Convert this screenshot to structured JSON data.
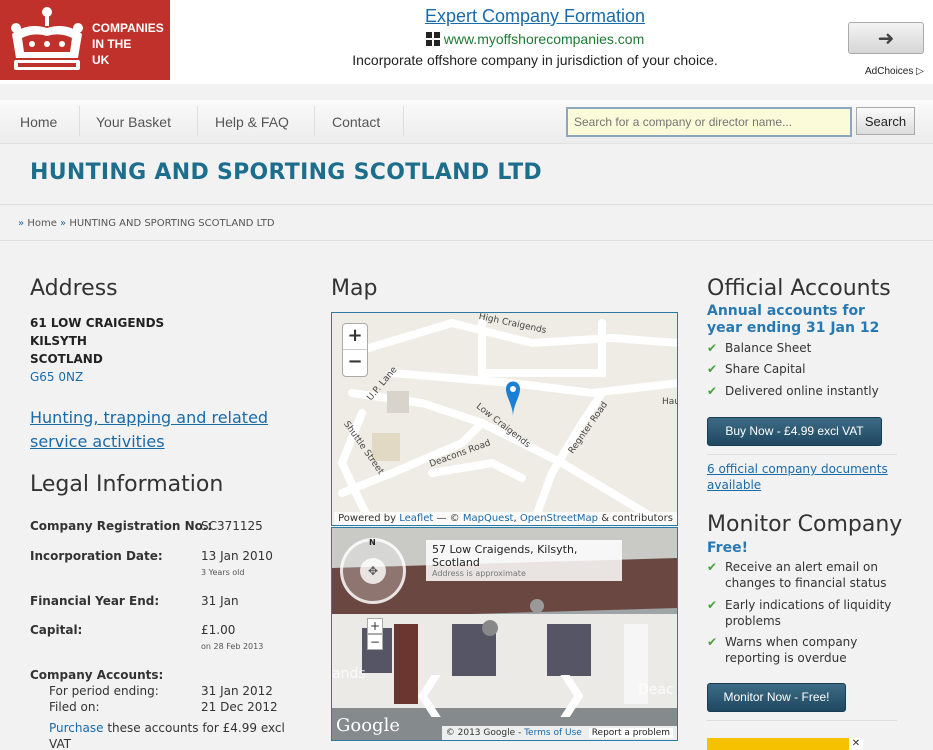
{
  "logo": {
    "line1": "COMPANIES",
    "line2": "IN THE",
    "line3": "UK"
  },
  "ad": {
    "title": "Expert Company Formation",
    "url": "www.myoffshorecompanies.com",
    "description": "Incorporate offshore company in jurisdiction of your choice.",
    "arrow": "➜",
    "adchoices": "AdChoices ▷"
  },
  "nav": {
    "items": [
      "Home",
      "Your Basket",
      "Help & FAQ",
      "Contact"
    ],
    "search_placeholder": "Search for a company or director name...",
    "search_button": "Search"
  },
  "page_title": "HUNTING AND SPORTING SCOTLAND LTD",
  "breadcrumb": {
    "sep": "»",
    "home": "Home",
    "current": "HUNTING AND SPORTING SCOTLAND LTD"
  },
  "address": {
    "heading": "Address",
    "line1": "61 LOW CRAIGENDS",
    "line2": "KILSYTH",
    "line3": "SCOTLAND",
    "postcode": "G65 0NZ",
    "activity": "Hunting, trapping and related service activities"
  },
  "legal": {
    "heading": "Legal Information",
    "reg_label": "Company Registration No.:",
    "reg_value": "SC371125",
    "inc_label": "Incorporation Date:",
    "inc_value": "13 Jan 2010",
    "inc_sub": "3 Years old",
    "fye_label": "Financial Year End:",
    "fye_value": "31 Jan",
    "cap_label": "Capital:",
    "cap_value": "£1.00",
    "cap_sub": "on 28 Feb 2013",
    "acc_label": "Company Accounts:",
    "period_label": "For period ending:",
    "period_value": "31 Jan 2012",
    "filed_label": "Filed on:",
    "filed_value": "21 Dec 2012",
    "purchase_link": "Purchase",
    "purchase_rest": " these accounts for £4.99 excl VAT"
  },
  "map": {
    "heading": "Map",
    "zoom_in": "+",
    "zoom_out": "−",
    "streets": [
      "High Craigends",
      "U.P. Lane",
      "Low Craigends",
      "Shuttle Street",
      "Deacons Road",
      "Regnter Road",
      "Hau"
    ],
    "attr_prefix": "Powered by ",
    "attr_leaflet": "Leaflet",
    "attr_mid": " — © ",
    "attr_mapquest": "MapQuest",
    "attr_sep": ", ",
    "attr_osm": "OpenStreetMap",
    "attr_suffix": " & contributors",
    "sv_address": "57 Low Craigends, Kilsyth, Scotland",
    "sv_approx": "Address is approximate",
    "sv_google": "Google",
    "sv_copyright": "© 2013 Google - ",
    "sv_terms": "Terms of Use",
    "sv_report": "Report a problem",
    "sv_compass": "N",
    "sv_deac": "Deac",
    "sv_ands": "ands"
  },
  "accounts": {
    "heading": "Official Accounts",
    "subheading": "Annual accounts for year ending 31 Jan 12",
    "items": [
      "Balance Sheet",
      "Share Capital",
      "Delivered online instantly"
    ],
    "buy_button": "Buy Now - £4.99 excl VAT",
    "docs_link": "6 official company documents available"
  },
  "monitor": {
    "heading": "Monitor Company",
    "free": "Free!",
    "items": [
      "Receive an alert email on changes to financial status",
      "Early indications of liquidity problems",
      "Warns when company reporting is overdue"
    ],
    "button": "Monitor Now - Free!"
  },
  "colors": {
    "brand_red": "#c0312b",
    "title_blue": "#1d6e8c",
    "link_blue": "#1a6aa8",
    "check_green": "#4aa03f",
    "button_dark": "#1f4860"
  }
}
